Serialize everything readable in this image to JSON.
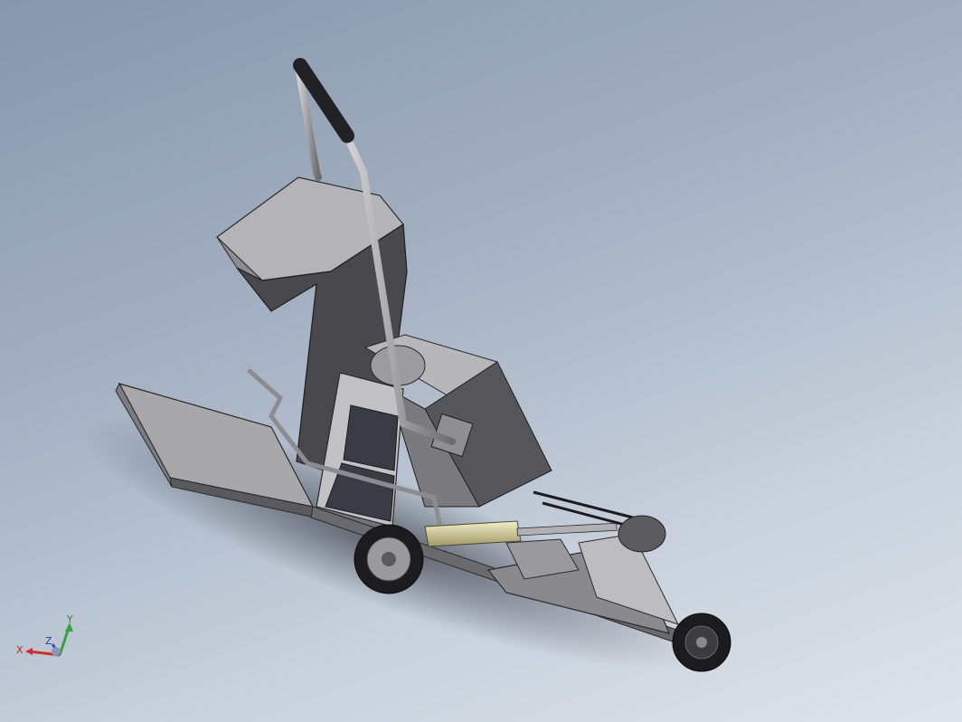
{
  "viewport": {
    "background_top": "#8797ac",
    "background_bottom": "#dde3ea"
  },
  "model": {
    "body_color": "#4a4a4f",
    "panel_color": "#9c9c9f",
    "frame_color": "#6e6e72",
    "tube_color": "#a6a6a8",
    "grip_color": "#222226",
    "cylinder_color": "#d8d1a0",
    "wheel_color": "#1c1c20"
  },
  "triad": {
    "x_label": "X",
    "y_label": "Y",
    "z_label": "Z",
    "x_color": "#d0302a",
    "y_color": "#3aa040",
    "z_color": "#3050c8"
  }
}
